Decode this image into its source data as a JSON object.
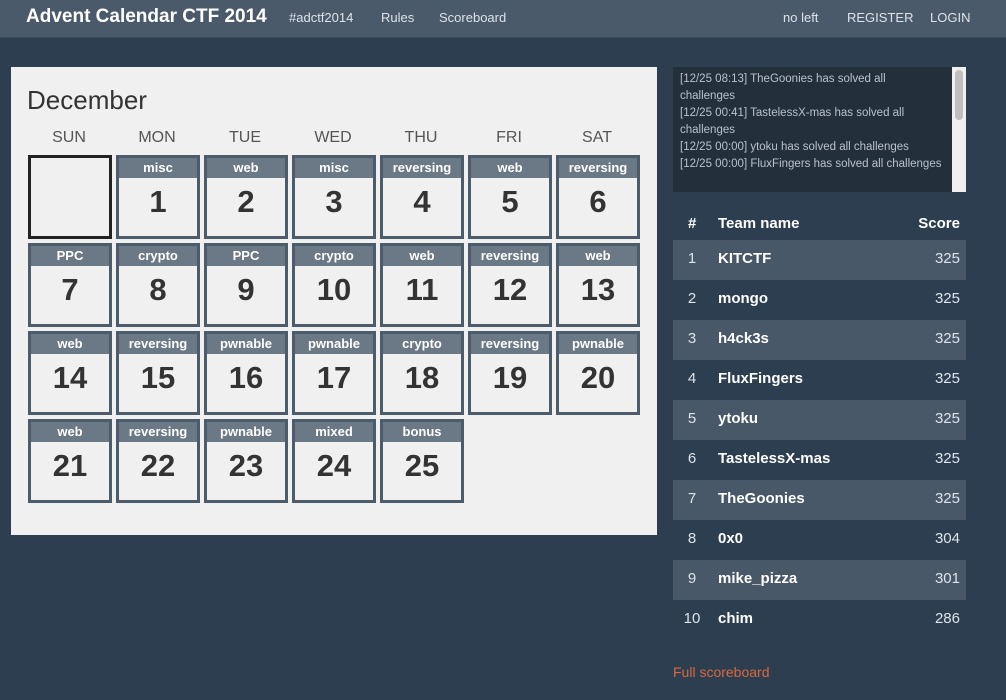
{
  "navbar": {
    "brand": "Advent Calendar CTF 2014",
    "links": [
      "#adctf2014",
      "Rules",
      "Scoreboard"
    ],
    "right_links": [
      "no left",
      "REGISTER",
      "LOGIN"
    ]
  },
  "calendar": {
    "month": "December",
    "weekdays": [
      "SUN",
      "MON",
      "TUE",
      "WED",
      "THU",
      "FRI",
      "SAT"
    ],
    "days": [
      {
        "day": "1",
        "category": "misc"
      },
      {
        "day": "2",
        "category": "web"
      },
      {
        "day": "3",
        "category": "misc"
      },
      {
        "day": "4",
        "category": "reversing"
      },
      {
        "day": "5",
        "category": "web"
      },
      {
        "day": "6",
        "category": "reversing"
      },
      {
        "day": "7",
        "category": "PPC"
      },
      {
        "day": "8",
        "category": "crypto"
      },
      {
        "day": "9",
        "category": "PPC"
      },
      {
        "day": "10",
        "category": "crypto"
      },
      {
        "day": "11",
        "category": "web"
      },
      {
        "day": "12",
        "category": "reversing"
      },
      {
        "day": "13",
        "category": "web"
      },
      {
        "day": "14",
        "category": "web"
      },
      {
        "day": "15",
        "category": "reversing"
      },
      {
        "day": "16",
        "category": "pwnable"
      },
      {
        "day": "17",
        "category": "pwnable"
      },
      {
        "day": "18",
        "category": "crypto"
      },
      {
        "day": "19",
        "category": "reversing"
      },
      {
        "day": "20",
        "category": "pwnable"
      },
      {
        "day": "21",
        "category": "web"
      },
      {
        "day": "22",
        "category": "reversing"
      },
      {
        "day": "23",
        "category": "pwnable"
      },
      {
        "day": "24",
        "category": "mixed"
      },
      {
        "day": "25",
        "category": "bonus"
      }
    ]
  },
  "log": [
    "[12/25 08:13] TheGoonies has solved all challenges",
    "[12/25 00:41] TastelessX-mas has solved all challenges",
    "[12/25 00:00] ytoku has solved all challenges",
    "[12/25 00:00] FluxFingers has solved all challenges"
  ],
  "scoreboard": {
    "headers": {
      "rank": "#",
      "team": "Team name",
      "score": "Score"
    },
    "rows": [
      {
        "rank": "1",
        "team": "KITCTF",
        "score": "325"
      },
      {
        "rank": "2",
        "team": "mongo",
        "score": "325"
      },
      {
        "rank": "3",
        "team": "h4ck3s",
        "score": "325"
      },
      {
        "rank": "4",
        "team": "FluxFingers",
        "score": "325"
      },
      {
        "rank": "5",
        "team": "ytoku",
        "score": "325"
      },
      {
        "rank": "6",
        "team": "TastelessX-mas",
        "score": "325"
      },
      {
        "rank": "7",
        "team": "TheGoonies",
        "score": "325"
      },
      {
        "rank": "8",
        "team": "0x0",
        "score": "304"
      },
      {
        "rank": "9",
        "team": "mike_pizza",
        "score": "301"
      },
      {
        "rank": "10",
        "team": "chim",
        "score": "286"
      }
    ],
    "full_link": "Full scoreboard"
  },
  "colors": {
    "background": "#2c3e50",
    "navbar": "#4a5a6b",
    "accent_link": "#d9683c",
    "cell_header": "#6b7885"
  }
}
